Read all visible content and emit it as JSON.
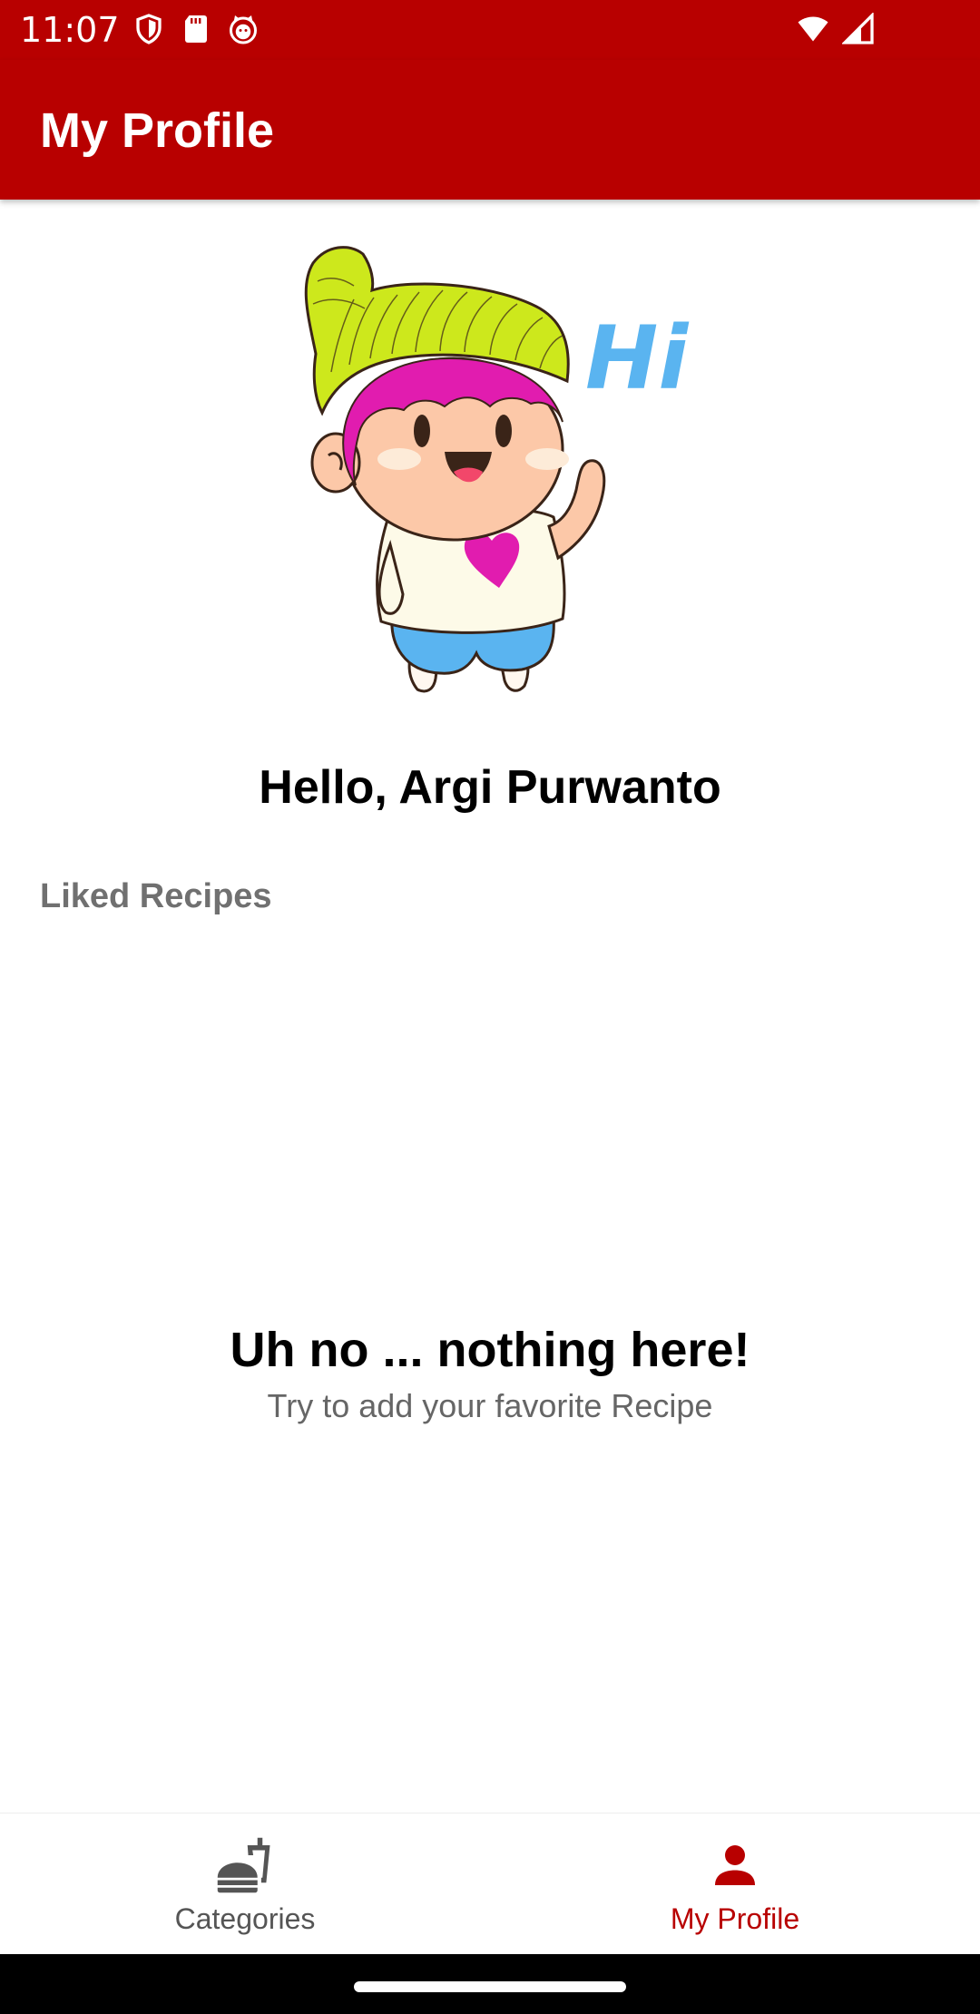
{
  "status_bar": {
    "time": "11:07",
    "left_icons": [
      "shield-icon",
      "sd-card-icon",
      "cat-face-icon"
    ],
    "right_icons": [
      "wifi-icon",
      "signal-icon"
    ]
  },
  "app_bar": {
    "title": "My Profile"
  },
  "profile": {
    "illustration": "hi-character-illustration",
    "illustration_text": "Hi",
    "greeting": "Hello, Argi Purwanto"
  },
  "liked_recipes": {
    "label": "Liked Recipes",
    "empty_title": "Uh no ... nothing here!",
    "empty_subtitle": "Try to add your favorite Recipe"
  },
  "bottom_nav": {
    "items": [
      {
        "label": "Categories",
        "icon": "fastfood-icon",
        "active": false
      },
      {
        "label": "My Profile",
        "icon": "person-icon",
        "active": true
      }
    ]
  },
  "colors": {
    "primary": "#b80000",
    "inactive": "#555555",
    "hi_text": "#5ab4f0"
  }
}
